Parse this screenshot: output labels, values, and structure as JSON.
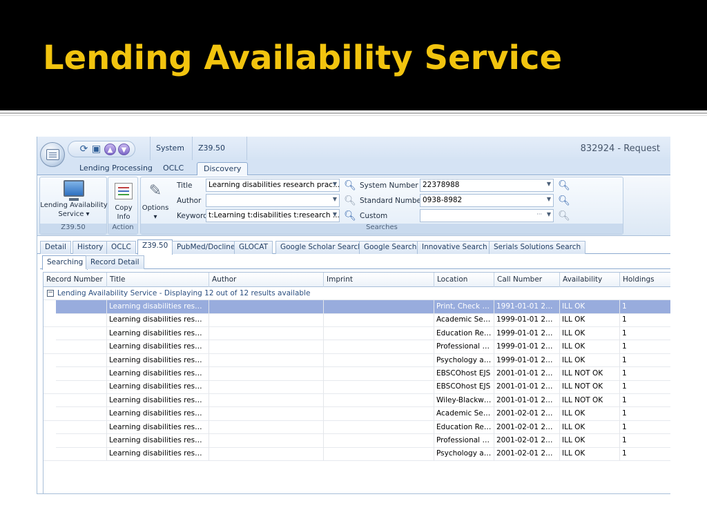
{
  "slide": {
    "title": "Lending Availability Service"
  },
  "app": {
    "quick_access_icons": [
      "refresh-icon",
      "save-icon",
      "up-icon",
      "down-icon"
    ],
    "context_tabs": [
      "System",
      "Z39.50"
    ],
    "request_label": "832924 - Request",
    "ribbon_tabs": [
      "Lending Processing",
      "OCLC",
      "Discovery"
    ],
    "active_ribbon_tab": "Discovery",
    "ribbon": {
      "lending_button": {
        "line1": "Lending Availability",
        "line2": "Service ▾"
      },
      "group_z3950_label": "Z39.50",
      "copy_button": {
        "line1": "Copy",
        "line2": "Info"
      },
      "options_button": {
        "line1": "Options",
        "line2": "▾"
      },
      "group_action_label": "Action",
      "searches_group_label": "Searches",
      "fields": {
        "title": {
          "label": "Title",
          "value": "Learning disabilities research prac..."
        },
        "author": {
          "label": "Author",
          "value": ""
        },
        "keyword": {
          "label": "Keyword",
          "value": "t:Learning t:disabilities t:research ..."
        },
        "system_number": {
          "label": "System Number",
          "value": "22378988"
        },
        "standard_number": {
          "label": "Standard Number",
          "value": "0938-8982"
        },
        "custom": {
          "label": "Custom",
          "value": "···"
        }
      }
    },
    "record_tabs": [
      "Detail",
      "History",
      "OCLC",
      "Z39.50",
      "PubMed/Docline",
      "GLOCAT",
      "Google Scholar Search",
      "Google Search",
      "Innovative Search",
      "Serials Solutions Search"
    ],
    "active_record_tab": "Z39.50",
    "sub_tabs": [
      "Searching",
      "Record Detail"
    ],
    "active_sub_tab": "Searching",
    "grid": {
      "columns": [
        "Record Number",
        "Title",
        "Author",
        "Imprint",
        "Location",
        "Call Number",
        "Availability",
        "Holdings"
      ],
      "group_text": "Lending Availability Service - Displaying 12 out of 12 results available",
      "selected_row": 0,
      "rows": [
        {
          "record_number": "",
          "title": "Learning disabilities researc...",
          "author": "",
          "imprint": "",
          "location": "Print, Check fo...",
          "call_number": "1991-01-01 200...",
          "availability": "ILL OK",
          "holdings": "1"
        },
        {
          "record_number": "",
          "title": "Learning disabilities researc...",
          "author": "",
          "imprint": "",
          "location": "Academic Sear...",
          "call_number": "1999-01-01 200...",
          "availability": "ILL OK",
          "holdings": "1"
        },
        {
          "record_number": "",
          "title": "Learning disabilities researc...",
          "author": "",
          "imprint": "",
          "location": "Education Res...",
          "call_number": "1999-01-01 200...",
          "availability": "ILL OK",
          "holdings": "1"
        },
        {
          "record_number": "",
          "title": "Learning disabilities researc...",
          "author": "",
          "imprint": "",
          "location": "Professional D...",
          "call_number": "1999-01-01 200...",
          "availability": "ILL OK",
          "holdings": "1"
        },
        {
          "record_number": "",
          "title": "Learning disabilities researc...",
          "author": "",
          "imprint": "",
          "location": "Psychology an...",
          "call_number": "1999-01-01 200...",
          "availability": "ILL OK",
          "holdings": "1"
        },
        {
          "record_number": "",
          "title": "Learning disabilities researc...",
          "author": "",
          "imprint": "",
          "location": "EBSCOhost EJS",
          "call_number": "2001-01-01 201...",
          "availability": "ILL NOT OK",
          "holdings": "1"
        },
        {
          "record_number": "",
          "title": "Learning disabilities researc...",
          "author": "",
          "imprint": "",
          "location": "EBSCOhost EJS",
          "call_number": "2001-01-01 201...",
          "availability": "ILL NOT OK",
          "holdings": "1"
        },
        {
          "record_number": "",
          "title": "Learning disabilities researc...",
          "author": "",
          "imprint": "",
          "location": "Wiley-Blackwell...",
          "call_number": "2001-01-01 201...",
          "availability": "ILL NOT OK",
          "holdings": "1"
        },
        {
          "record_number": "",
          "title": "Learning disabilities researc...",
          "author": "",
          "imprint": "",
          "location": "Academic Sear...",
          "call_number": "2001-02-01 200...",
          "availability": "ILL OK",
          "holdings": "1"
        },
        {
          "record_number": "",
          "title": "Learning disabilities researc...",
          "author": "",
          "imprint": "",
          "location": "Education Res...",
          "call_number": "2001-02-01 200...",
          "availability": "ILL OK",
          "holdings": "1"
        },
        {
          "record_number": "",
          "title": "Learning disabilities researc...",
          "author": "",
          "imprint": "",
          "location": "Professional D...",
          "call_number": "2001-02-01 200...",
          "availability": "ILL OK",
          "holdings": "1"
        },
        {
          "record_number": "",
          "title": "Learning disabilities researc...",
          "author": "",
          "imprint": "",
          "location": "Psychology an...",
          "call_number": "2001-02-01 200...",
          "availability": "ILL OK",
          "holdings": "1"
        }
      ]
    },
    "colors": {
      "selection": "#98acdd",
      "title_yellow": "#f2c40f",
      "slide_background": "#000000"
    }
  }
}
